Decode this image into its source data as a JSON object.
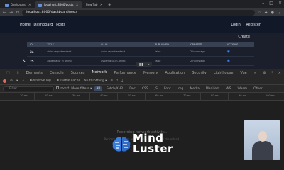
{
  "browser": {
    "tabs": [
      {
        "label": "Dashboard"
      },
      {
        "label": "localhost:8000/posts"
      },
      {
        "label": "New Tab"
      }
    ],
    "url": "localhost:8000/dashboard/posts"
  },
  "site": {
    "nav": [
      "Home",
      "Dashboard",
      "Posts"
    ],
    "auth": [
      "Login",
      "Register"
    ],
    "create_label": "Create",
    "table": {
      "headers": [
        "ID",
        "TITLE",
        "SLUG",
        "PUBLISHED",
        "CREATED",
        "ACTIONS"
      ],
      "rows": [
        {
          "id": "24",
          "title": "dolor reprehenderit",
          "slug": "dolor-reprehenderit",
          "published": "false",
          "created": "2 hours ago"
        },
        {
          "id": "25",
          "title": "aspernatur in animi",
          "slug": "aspernatur-in-animi",
          "published": "false",
          "created": "2 hours ago"
        }
      ]
    }
  },
  "devtools": {
    "tabs": [
      "Elements",
      "Console",
      "Sources",
      "Network",
      "Performance",
      "Memory",
      "Application",
      "Security",
      "Lighthouse",
      "Vue"
    ],
    "active_tab": "Network",
    "toolbar": {
      "preserve_log": "Preserve log",
      "disable_cache": "Disable cache",
      "throttle": "No throttling"
    },
    "filter": {
      "placeholder": "Filter",
      "invert": "Invert",
      "more_filters": "More filters",
      "types": [
        "All",
        "Fetch/XHR",
        "Doc",
        "CSS",
        "JS",
        "Font",
        "Img",
        "Media",
        "Manifest",
        "WS",
        "Wasm",
        "Other"
      ],
      "active_type": "All"
    },
    "timeline_ticks": [
      "10 ms",
      "20 ms",
      "30 ms",
      "40 ms",
      "50 ms",
      "60 ms",
      "70 ms",
      "80 ms",
      "90 ms",
      "100 ms"
    ],
    "empty": {
      "title": "Recording network activity...",
      "hint": "Perform a request or hit Ctrl + R to record the reload."
    }
  },
  "watermark": {
    "line1": "Mind",
    "line2": "Luster"
  }
}
